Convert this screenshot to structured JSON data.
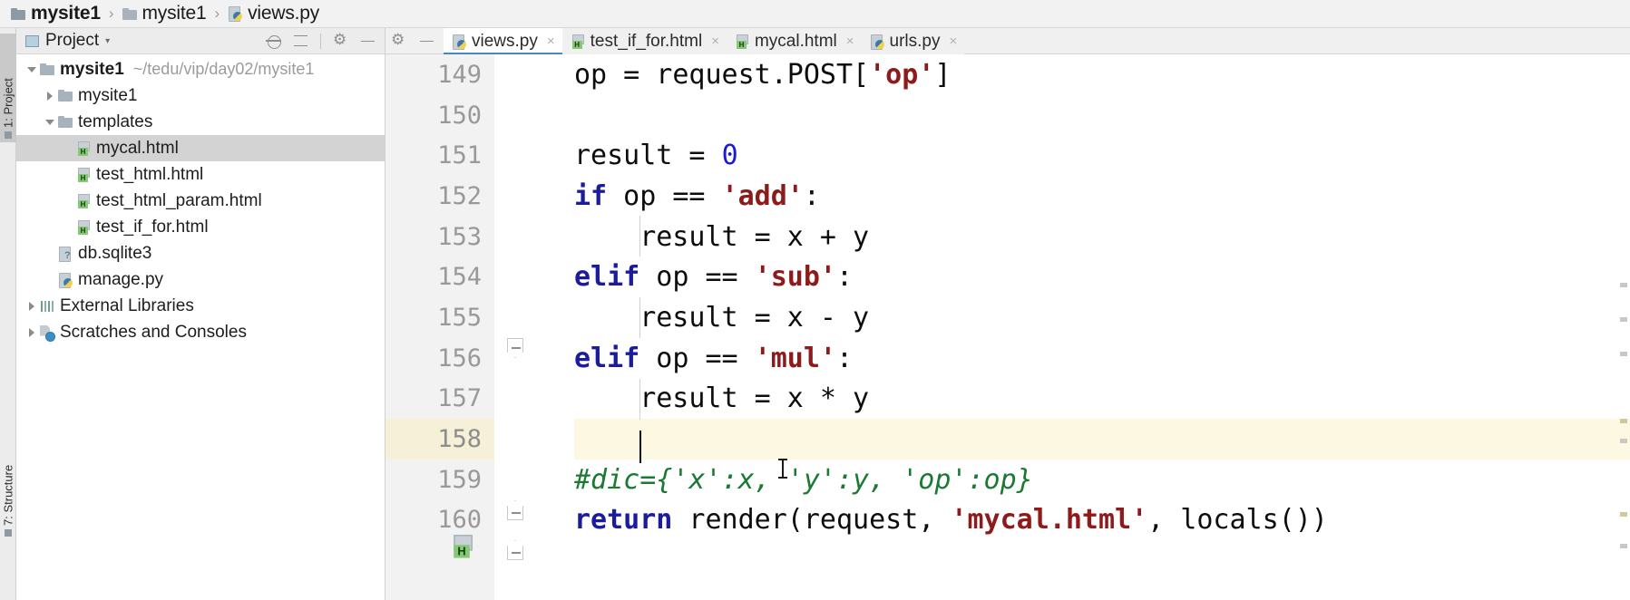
{
  "breadcrumb": {
    "items": [
      {
        "label": "mysite1",
        "icon": "folder-icon"
      },
      {
        "label": "mysite1",
        "icon": "folder-icon"
      },
      {
        "label": "views.py",
        "icon": "python-file-icon"
      }
    ],
    "separator": "›"
  },
  "tool_strip": {
    "project_button": "1: Project",
    "structure_button": "7: Structure"
  },
  "project_panel": {
    "title": "Project",
    "caret": "▾",
    "actions": [
      "locate-icon",
      "collapse-all-icon",
      "gear-icon",
      "hide-icon"
    ],
    "tree": [
      {
        "label": "mysite1",
        "sub": "~/tedu/vip/day02/mysite1",
        "icon": "folder-icon",
        "arrow": "open",
        "indent": 0,
        "bold": true,
        "selected": false
      },
      {
        "label": "mysite1",
        "sub": "",
        "icon": "folder-icon",
        "arrow": "closed",
        "indent": 1,
        "bold": false,
        "selected": false
      },
      {
        "label": "templates",
        "sub": "",
        "icon": "folder-icon",
        "arrow": "open",
        "indent": 1,
        "bold": false,
        "selected": false
      },
      {
        "label": "mycal.html",
        "sub": "",
        "icon": "html-file-icon",
        "arrow": "none",
        "indent": 2,
        "bold": false,
        "selected": true
      },
      {
        "label": "test_html.html",
        "sub": "",
        "icon": "html-file-icon",
        "arrow": "none",
        "indent": 2,
        "bold": false,
        "selected": false
      },
      {
        "label": "test_html_param.html",
        "sub": "",
        "icon": "html-file-icon",
        "arrow": "none",
        "indent": 2,
        "bold": false,
        "selected": false
      },
      {
        "label": "test_if_for.html",
        "sub": "",
        "icon": "html-file-icon",
        "arrow": "none",
        "indent": 2,
        "bold": false,
        "selected": false
      },
      {
        "label": "db.sqlite3",
        "sub": "",
        "icon": "database-file-icon",
        "arrow": "none",
        "indent": 1,
        "bold": false,
        "selected": false
      },
      {
        "label": "manage.py",
        "sub": "",
        "icon": "python-file-icon",
        "arrow": "none",
        "indent": 1,
        "bold": false,
        "selected": false
      },
      {
        "label": "External Libraries",
        "sub": "",
        "icon": "libraries-icon",
        "arrow": "closed",
        "indent": 0,
        "bold": false,
        "selected": false
      },
      {
        "label": "Scratches and Consoles",
        "sub": "",
        "icon": "scratches-icon",
        "arrow": "closed",
        "indent": 0,
        "bold": false,
        "selected": false
      }
    ]
  },
  "editor": {
    "tabs": [
      {
        "label": "views.py",
        "icon": "python-file-icon",
        "active": true,
        "close": "×"
      },
      {
        "label": "test_if_for.html",
        "icon": "html-file-icon",
        "active": false,
        "close": "×"
      },
      {
        "label": "mycal.html",
        "icon": "html-file-icon",
        "active": false,
        "close": "×"
      },
      {
        "label": "urls.py",
        "icon": "python-file-icon",
        "active": false,
        "close": "×"
      }
    ],
    "tab_actions": [
      "gear-icon",
      "hide-icon"
    ],
    "first_visible_line": 149,
    "caret_line": 158,
    "lines": [
      {
        "num": "149",
        "text": "        op = request.POST['op']"
      },
      {
        "num": "150",
        "text": ""
      },
      {
        "num": "151",
        "text": "        result = 0"
      },
      {
        "num": "152",
        "text": "        if op == 'add':"
      },
      {
        "num": "153",
        "text": "            result = x + y"
      },
      {
        "num": "154",
        "text": "        elif op == 'sub':"
      },
      {
        "num": "155",
        "text": "            result = x - y"
      },
      {
        "num": "156",
        "text": "        elif op == 'mul':"
      },
      {
        "num": "157",
        "text": "            result = x * y"
      },
      {
        "num": "158",
        "text": ""
      },
      {
        "num": "159",
        "text": "        #dic={'x':x, 'y':y, 'op':op}"
      },
      {
        "num": "160",
        "text": "        return render(request, 'mycal.html', locals())"
      }
    ]
  },
  "colors": {
    "keyword": "#1b1b9e",
    "string": "#8d1b1b",
    "number": "#1a1ad6",
    "comment": "#1a7a32",
    "highlight_line": "#fcf8e2",
    "selection": "#d3d3d3",
    "active_tab_underline": "#4b86c4"
  }
}
